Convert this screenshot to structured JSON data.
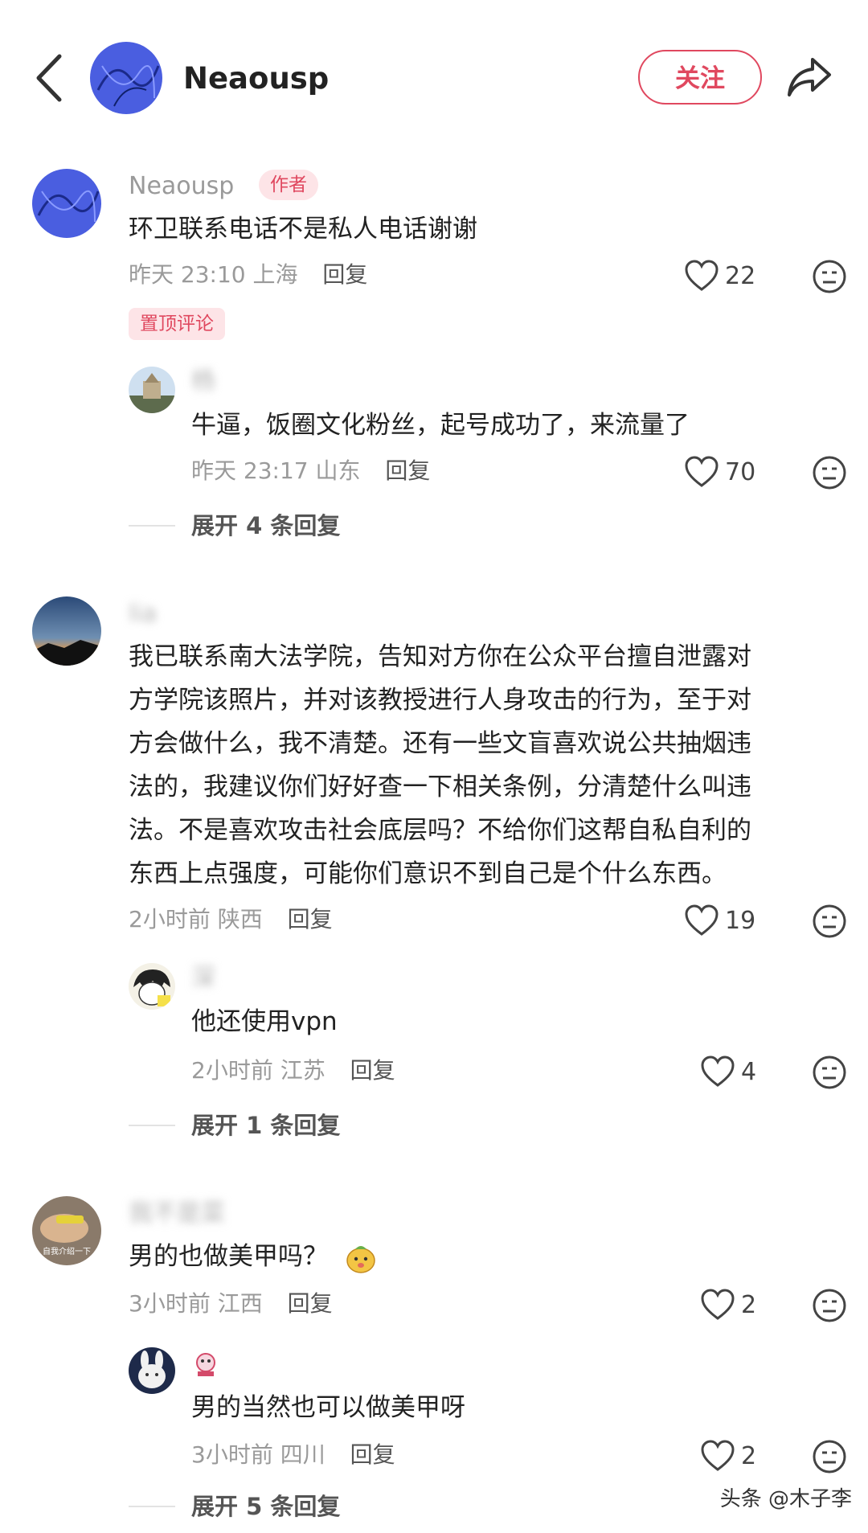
{
  "header": {
    "username": "Neaousp",
    "follow_label": "关注"
  },
  "comments": [
    {
      "username": "Neaousp",
      "author_tag": "作者",
      "text": "环卫联系电话不是私人电话谢谢",
      "time": "昨天 23:10",
      "location": "上海",
      "reply_label": "回复",
      "likes": "22",
      "pin_tag": "置顶评论",
      "reply": {
        "username": "杨",
        "text": "牛逼，饭圈文化粉丝，起号成功了，来流量了",
        "time": "昨天 23:17",
        "location": "山东",
        "reply_label": "回复",
        "likes": "70"
      },
      "expand_label": "展开 4 条回复"
    },
    {
      "username": "lia",
      "text_lines": [
        "我已联系南大法学院，告知对方你在公众平台擅自泄露对",
        "方学院该照片，并对该教授进行人身攻击的行为，至于对",
        "方会做什么，我不清楚。还有一些文盲喜欢说公共抽烟违",
        "法的，我建议你们好好查一下相关条例，分清楚什么叫违",
        "法。不是喜欢攻击社会底层吗？不给你们这帮自私自利的",
        "东西上点强度，可能你们意识不到自己是个什么东西。"
      ],
      "time": "2小时前",
      "location": "陕西",
      "reply_label": "回复",
      "likes": "19",
      "reply": {
        "username": "深",
        "text": "他还使用vpn",
        "time": "2小时前",
        "location": "江苏",
        "reply_label": "回复",
        "likes": "4"
      },
      "expand_label": "展开 1 条回复"
    },
    {
      "username": "我不是菜",
      "avatar_caption": "自我介绍一下",
      "text": "男的也做美甲吗？",
      "time": "3小时前",
      "location": "江西",
      "reply_label": "回复",
      "likes": "2",
      "reply": {
        "username": "",
        "text": "男的当然也可以做美甲呀",
        "time": "3小时前",
        "location": "四川",
        "reply_label": "回复",
        "likes": "2"
      },
      "expand_label": "展开 5 条回复"
    }
  ],
  "watermark": "头条 @木子李",
  "colors": {
    "accent": "#e0485f",
    "meta": "#9a9a9a",
    "tag_bg": "#fde4e7"
  }
}
